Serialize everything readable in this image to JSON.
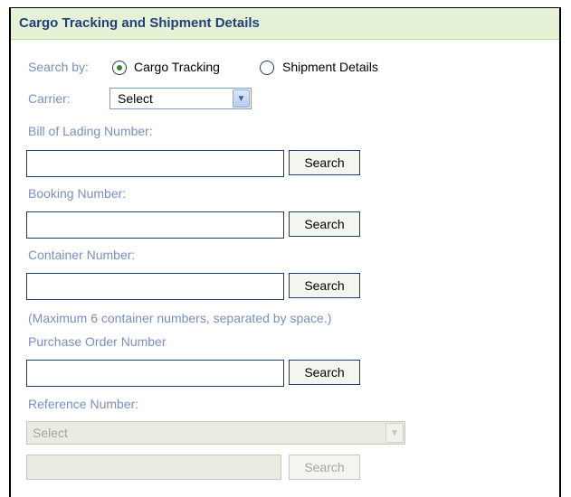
{
  "panel": {
    "title": "Cargo Tracking and Shipment Details"
  },
  "search_by": {
    "label": "Search by:",
    "options": [
      {
        "label": "Cargo Tracking",
        "selected": true
      },
      {
        "label": "Shipment Details",
        "selected": false
      }
    ]
  },
  "carrier": {
    "label": "Carrier:",
    "selected": "Select"
  },
  "bill_of_lading": {
    "label": "Bill of Lading Number:",
    "value": "",
    "button": "Search"
  },
  "booking": {
    "label": "Booking Number:",
    "value": "",
    "button": "Search"
  },
  "container": {
    "label": "Container Number:",
    "value": "",
    "button": "Search",
    "hint": "(Maximum 6 container numbers, separated by space.)"
  },
  "purchase_order": {
    "label": "Purchase Order Number",
    "value": "",
    "button": "Search"
  },
  "reference": {
    "label": "Reference Number:",
    "selected": "Select",
    "value": "",
    "button": "Search",
    "disabled": true
  },
  "icons": {
    "dropdown": "chevron-down-icon"
  },
  "colors": {
    "header_bg": "#e6f2d6",
    "header_text": "#23407a",
    "label": "#7a8fbe",
    "radio_dot": "#2f8a2f"
  }
}
